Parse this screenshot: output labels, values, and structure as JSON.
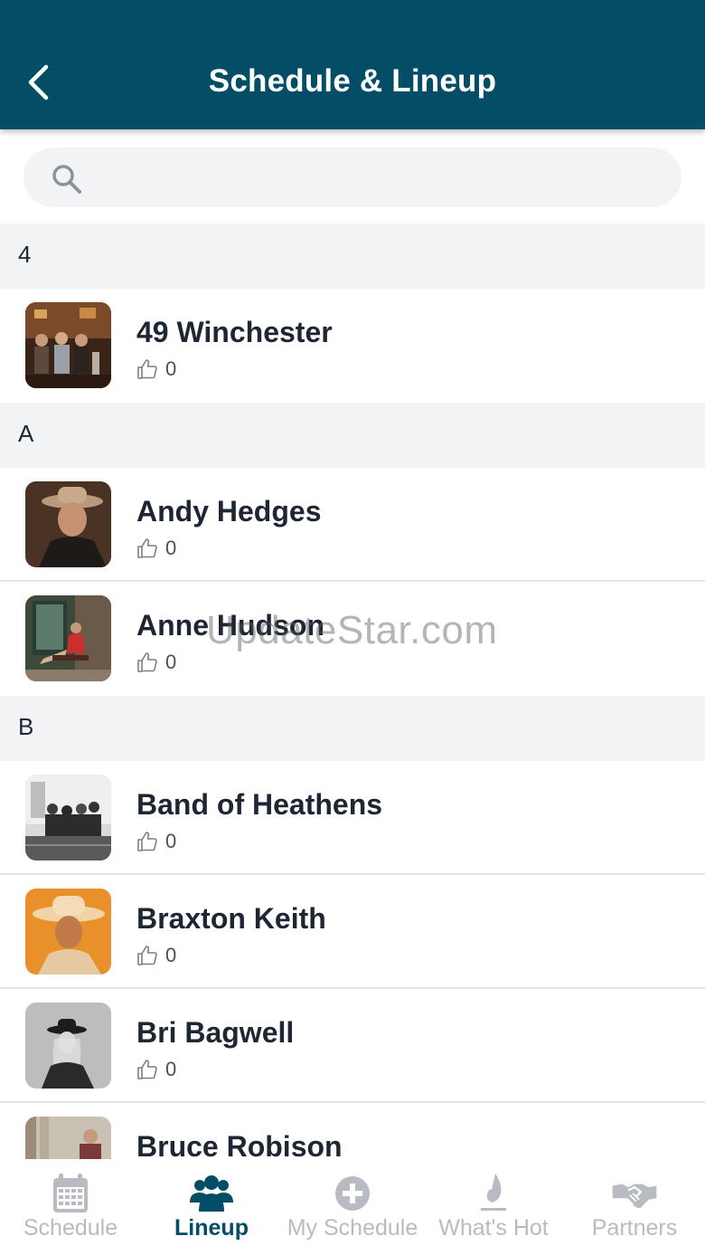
{
  "header": {
    "title": "Schedule & Lineup"
  },
  "search": {
    "placeholder": ""
  },
  "sections": [
    {
      "letter": "4",
      "artists": [
        {
          "name": "49 Winchester",
          "likes": "0"
        }
      ]
    },
    {
      "letter": "A",
      "artists": [
        {
          "name": "Andy Hedges",
          "likes": "0"
        },
        {
          "name": "Anne Hudson",
          "likes": "0"
        }
      ]
    },
    {
      "letter": "B",
      "artists": [
        {
          "name": "Band of Heathens",
          "likes": "0"
        },
        {
          "name": "Braxton Keith",
          "likes": "0"
        },
        {
          "name": "Bri Bagwell",
          "likes": "0"
        },
        {
          "name": "Bruce Robison",
          "likes": ""
        }
      ]
    }
  ],
  "watermark": "UpdateStar.com",
  "tabs": [
    {
      "label": "Schedule",
      "icon": "calendar-icon",
      "active": false
    },
    {
      "label": "Lineup",
      "icon": "group-icon",
      "active": true
    },
    {
      "label": "My Schedule",
      "icon": "plus-circle-icon",
      "active": false
    },
    {
      "label": "What's Hot",
      "icon": "flame-icon",
      "active": false
    },
    {
      "label": "Partners",
      "icon": "handshake-icon",
      "active": false
    }
  ],
  "colors": {
    "header_bg": "#044d66",
    "active_tab": "#044d66",
    "inactive_tab": "#b8bcc2",
    "section_bg": "#f2f3f5"
  }
}
